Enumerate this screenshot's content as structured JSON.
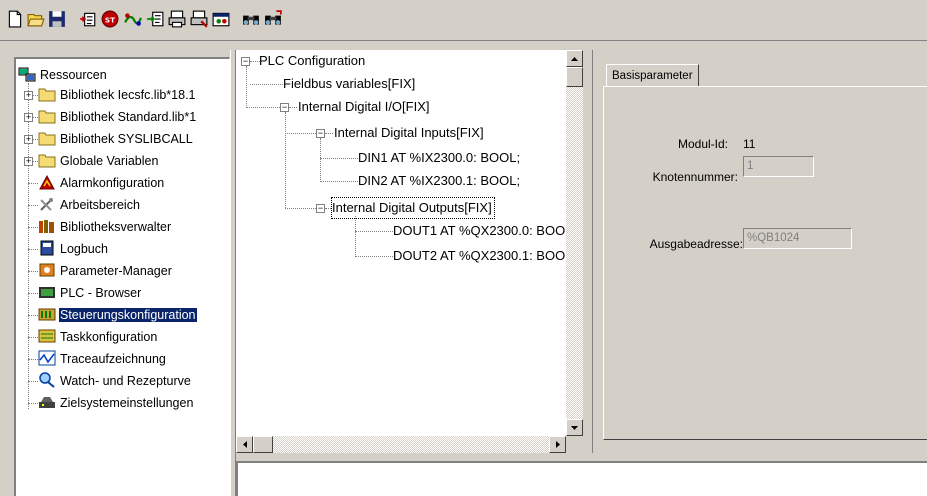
{
  "toolbar": {
    "buttons": [
      "new-file-icon",
      "open-folder-icon",
      "save-icon",
      "insert-element-icon",
      "stop-icon",
      "online-connect-icon",
      "append-element-icon",
      "print-preview-icon",
      "print-setup-icon",
      "watch-icon",
      "find-icon",
      "find-replace-icon"
    ]
  },
  "resources": {
    "root": "Ressourcen",
    "items": [
      {
        "label": "Bibliothek Iecsfc.lib*18.1",
        "icon": "folder-icon",
        "expandable": true
      },
      {
        "label": "Bibliothek Standard.lib*1",
        "icon": "folder-icon",
        "expandable": true
      },
      {
        "label": "Bibliothek SYSLIBCALL",
        "icon": "folder-icon",
        "expandable": true
      },
      {
        "label": "Globale Variablen",
        "icon": "folder-icon",
        "expandable": true
      },
      {
        "label": "Alarmkonfiguration",
        "icon": "alarm-icon",
        "expandable": false
      },
      {
        "label": "Arbeitsbereich",
        "icon": "tools-icon",
        "expandable": false
      },
      {
        "label": "Bibliotheksverwalter",
        "icon": "library-icon",
        "expandable": false
      },
      {
        "label": "Logbuch",
        "icon": "logbook-icon",
        "expandable": false
      },
      {
        "label": "Parameter-Manager",
        "icon": "parameter-icon",
        "expandable": false
      },
      {
        "label": "PLC - Browser",
        "icon": "browser-icon",
        "expandable": false
      },
      {
        "label": "Steuerungskonfiguration",
        "icon": "plc-config-icon",
        "expandable": false,
        "selected": true
      },
      {
        "label": "Taskkonfiguration",
        "icon": "task-icon",
        "expandable": false
      },
      {
        "label": "Traceaufzeichnung",
        "icon": "trace-icon",
        "expandable": false
      },
      {
        "label": "Watch- und Rezepturve",
        "icon": "watch-icon",
        "expandable": false
      },
      {
        "label": "Zielsystemeinstellungen",
        "icon": "target-icon",
        "expandable": false
      }
    ]
  },
  "config_tree": {
    "root": "PLC Configuration",
    "fieldbus": "Fieldbus variables[FIX]",
    "internal_io": "Internal Digital I/O[FIX]",
    "inputs": "Internal Digital Inputs[FIX]",
    "din1": "DIN1 AT %IX2300.0: BOOL;",
    "din2": "DIN2 AT %IX2300.1: BOOL;",
    "outputs": "Internal Digital Outputs[FIX]",
    "dout1": "DOUT1 AT %QX2300.0: BOO",
    "dout2": "DOUT2 AT %QX2300.1: BOO"
  },
  "properties": {
    "tab": "Basisparameter",
    "modul_id_label": "Modul-Id:",
    "modul_id_value": "11",
    "knoten_label": "Knotennummer:",
    "knoten_value": "1",
    "ausgabe_label": "Ausgabeadresse:",
    "ausgabe_value": "%QB1024"
  },
  "colors": {
    "face": "#d4d0c8",
    "selection": "#0a246a",
    "shadow": "#808080"
  }
}
